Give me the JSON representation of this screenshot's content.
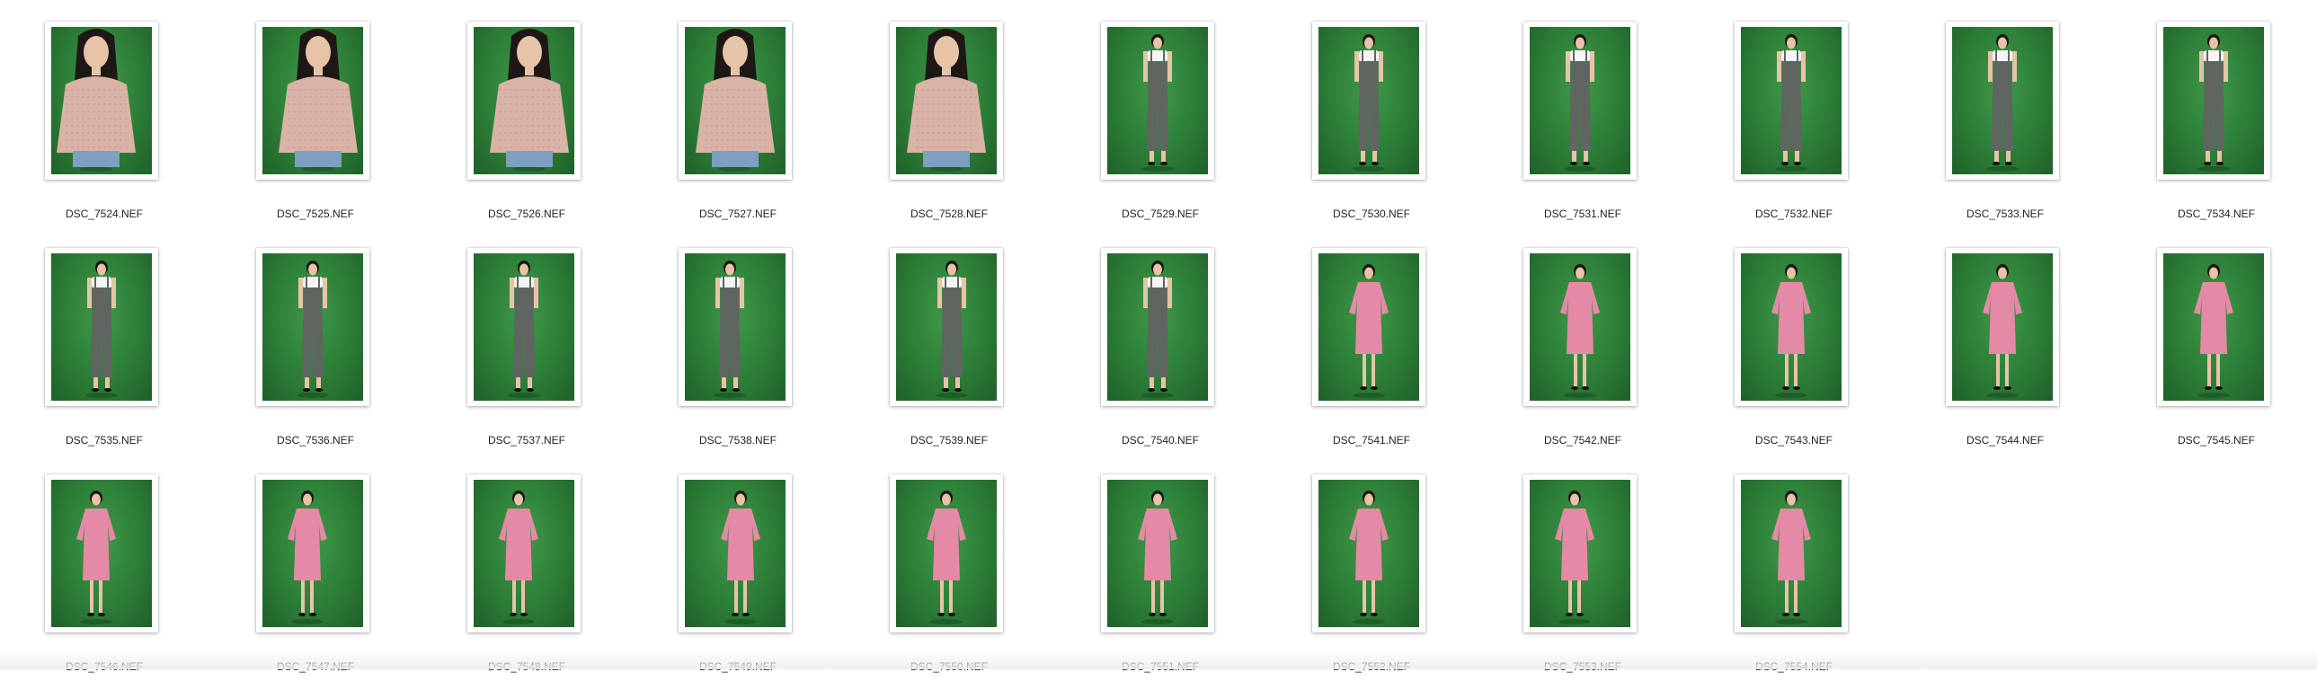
{
  "files": [
    {
      "name": "DSC_7524.NEF",
      "outfit": "lace-top",
      "pose": "side-left"
    },
    {
      "name": "DSC_7525.NEF",
      "outfit": "lace-top",
      "pose": "side-right"
    },
    {
      "name": "DSC_7526.NEF",
      "outfit": "lace-top",
      "pose": "side-right"
    },
    {
      "name": "DSC_7527.NEF",
      "outfit": "lace-top",
      "pose": "front"
    },
    {
      "name": "DSC_7528.NEF",
      "outfit": "lace-top",
      "pose": "front"
    },
    {
      "name": "DSC_7529.NEF",
      "outfit": "gray-overalls",
      "pose": "front"
    },
    {
      "name": "DSC_7530.NEF",
      "outfit": "gray-overalls",
      "pose": "front"
    },
    {
      "name": "DSC_7531.NEF",
      "outfit": "gray-overalls",
      "pose": "front"
    },
    {
      "name": "DSC_7532.NEF",
      "outfit": "gray-overalls",
      "pose": "front"
    },
    {
      "name": "DSC_7533.NEF",
      "outfit": "gray-overalls",
      "pose": "front"
    },
    {
      "name": "DSC_7534.NEF",
      "outfit": "gray-overalls",
      "pose": "front"
    },
    {
      "name": "DSC_7535.NEF",
      "outfit": "gray-overalls",
      "pose": "front"
    },
    {
      "name": "DSC_7536.NEF",
      "outfit": "gray-overalls",
      "pose": "front"
    },
    {
      "name": "DSC_7537.NEF",
      "outfit": "gray-overalls",
      "pose": "front"
    },
    {
      "name": "DSC_7538.NEF",
      "outfit": "gray-overalls",
      "pose": "side-left"
    },
    {
      "name": "DSC_7539.NEF",
      "outfit": "gray-overalls",
      "pose": "side-right"
    },
    {
      "name": "DSC_7540.NEF",
      "outfit": "gray-overalls",
      "pose": "front"
    },
    {
      "name": "DSC_7541.NEF",
      "outfit": "pink-dress",
      "pose": "front"
    },
    {
      "name": "DSC_7542.NEF",
      "outfit": "pink-dress",
      "pose": "front"
    },
    {
      "name": "DSC_7543.NEF",
      "outfit": "pink-dress",
      "pose": "front"
    },
    {
      "name": "DSC_7544.NEF",
      "outfit": "pink-dress",
      "pose": "front"
    },
    {
      "name": "DSC_7545.NEF",
      "outfit": "pink-dress",
      "pose": "front"
    },
    {
      "name": "DSC_7546.NEF",
      "outfit": "pink-dress",
      "pose": "side-left"
    },
    {
      "name": "DSC_7547.NEF",
      "outfit": "pink-dress",
      "pose": "side-left"
    },
    {
      "name": "DSC_7548.NEF",
      "outfit": "pink-dress",
      "pose": "side-left"
    },
    {
      "name": "DSC_7549.NEF",
      "outfit": "pink-dress",
      "pose": "side-right"
    },
    {
      "name": "DSC_7550.NEF",
      "outfit": "pink-dress",
      "pose": "front"
    },
    {
      "name": "DSC_7551.NEF",
      "outfit": "pink-dress",
      "pose": "front"
    },
    {
      "name": "DSC_7552.NEF",
      "outfit": "pink-dress",
      "pose": "front"
    },
    {
      "name": "DSC_7553.NEF",
      "outfit": "pink-dress",
      "pose": "side-left"
    },
    {
      "name": "DSC_7554.NEF",
      "outfit": "pink-dress",
      "pose": "front"
    }
  ],
  "colors": {
    "backdrop": "#2d7f37",
    "lace_top": "#d9b3a6",
    "overalls": "#5f6560",
    "tee": "#f4f4f4",
    "pink_dress": "#e48aa6",
    "skin": "#e7c3a8",
    "hair": "#1d1815"
  }
}
